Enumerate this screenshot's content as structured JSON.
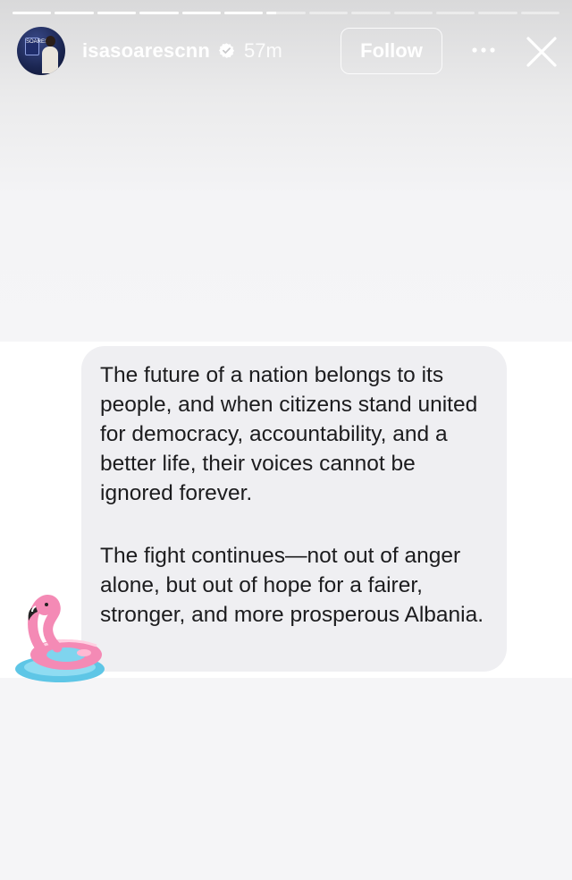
{
  "story": {
    "progress_segments_total": 13,
    "progress_segments_viewed": 6,
    "current_segment_fraction": 0.25
  },
  "header": {
    "username": "isasoarescnn",
    "verified": true,
    "time_ago": "57m",
    "follow_label": "Follow",
    "avatar_label": "SOARES",
    "icons": {
      "verified": "verified-badge-icon",
      "more": "more-options-icon",
      "close": "close-icon"
    }
  },
  "message": {
    "paragraph_1": "The future of a nation belongs to its people, and when citizens stand united for democracy, accountability, and a better life, their voices cannot be ignored forever.",
    "paragraph_2": "The fight continues—not out of anger alone, but out of hope for a fairer, stronger, and more prosperous Albania."
  },
  "sticker": {
    "icon": "flamingo-float-sticker",
    "colors": {
      "pink": "#f48ab5",
      "water": "#5ec6e6"
    }
  },
  "colors": {
    "bubble_bg": "#efeff2",
    "text": "#1c1c1e",
    "header_text": "#ffffff"
  }
}
